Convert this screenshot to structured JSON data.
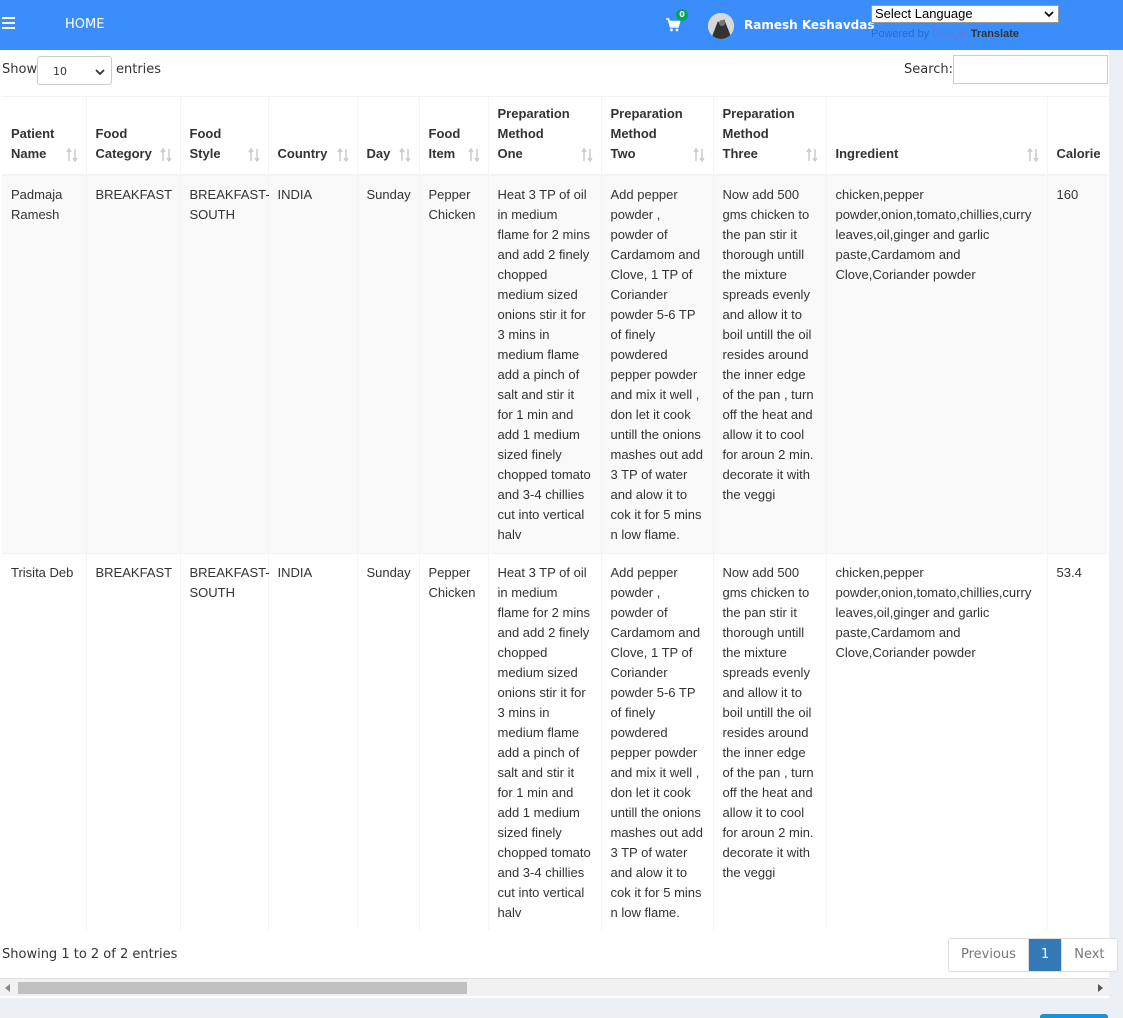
{
  "navbar": {
    "home_label": "HOME",
    "cart_count": "0",
    "user_name": "Ramesh Keshavdas",
    "language_select": "Select Language",
    "powered_by": "Powered by",
    "google": "Google",
    "translate": "Translate",
    "bg_color": "#3c8dfc"
  },
  "controls": {
    "show_label": "Show",
    "length_value": "10",
    "entries_label": "entries",
    "search_label": "Search:",
    "search_value": ""
  },
  "table": {
    "headers": [
      {
        "line1": "Patient",
        "line2": "Name",
        "line3": ""
      },
      {
        "line1": "Food",
        "line2": "Category",
        "line3": ""
      },
      {
        "line1": "Food",
        "line2": "Style",
        "line3": ""
      },
      {
        "line1": "",
        "line2": "Country",
        "line3": ""
      },
      {
        "line1": "",
        "line2": "Day",
        "line3": ""
      },
      {
        "line1": "Food",
        "line2": "Item",
        "line3": ""
      },
      {
        "line1": "Preparation",
        "line2": "Method",
        "line3": "One"
      },
      {
        "line1": "Preparation",
        "line2": "Method",
        "line3": "Two"
      },
      {
        "line1": "Preparation",
        "line2": "Method",
        "line3": "Three"
      },
      {
        "line1": "",
        "line2": "Ingredient",
        "line3": ""
      },
      {
        "line1": "",
        "line2": "Calorie",
        "line3": ""
      }
    ],
    "rows": [
      {
        "patient": "Padmaja Ramesh",
        "category": "BREAKFAST",
        "style": "BREAKFAST-SOUTH",
        "country": "INDIA",
        "day": "Sunday",
        "item": "Pepper Chicken",
        "prep1": "Heat 3 TP of oil in medium flame for 2 mins and add 2 finely chopped medium sized onions stir it for 3 mins in medium flame add a pinch of salt and stir it for 1 min and add 1 medium sized finely chopped tomato and 3-4 chillies cut into vertical halv",
        "prep2": "Add pepper powder , powder of Cardamom and Clove, 1 TP of Coriander powder 5-6 TP of finely powdered pepper powder and mix it well , don let it cook untill the onions mashes out add 3 TP of water and alow it to cok it for 5 mins n low flame.",
        "prep3": "Now add 500 gms chicken to the pan stir it thorough untill the mixture spreads evenly and allow it to boil untill the oil resides around the inner edge of the pan , turn off the heat and allow it to cool for aroun 2 min. decorate it with the veggi",
        "ingredient": "chicken,pepper powder,onion,tomato,chillies,curry leaves,oil,ginger and garlic paste,Cardamom and Clove,Coriander powder",
        "calorie": "160"
      },
      {
        "patient": "Trisita Deb",
        "category": "BREAKFAST",
        "style": "BREAKFAST-SOUTH",
        "country": "INDIA",
        "day": "Sunday",
        "item": "Pepper Chicken",
        "prep1": "Heat 3 TP of oil in medium flame for 2 mins and add 2 finely chopped medium sized onions stir it for 3 mins in medium flame add a pinch of salt and stir it for 1 min and add 1 medium sized finely chopped tomato and 3-4 chillies cut into vertical halv",
        "prep2": "Add pepper powder , powder of Cardamom and Clove, 1 TP of Coriander powder 5-6 TP of finely powdered pepper powder and mix it well , don let it cook untill the onions mashes out add 3 TP of water and alow it to cok it for 5 mins n low flame.",
        "prep3": "Now add 500 gms chicken to the pan stir it thorough untill the mixture spreads evenly and allow it to boil untill the oil resides around the inner edge of the pan , turn off the heat and allow it to cool for aroun 2 min. decorate it with the veggi",
        "ingredient": "chicken,pepper powder,onion,tomato,chillies,curry leaves,oil,ginger and garlic paste,Cardamom and Clove,Coriander powder",
        "calorie": "53.4"
      }
    ]
  },
  "footer": {
    "info": "Showing 1 to 2 of 2 entries",
    "previous": "Previous",
    "current_page": "1",
    "next": "Next",
    "active_color": "#337ab7"
  }
}
